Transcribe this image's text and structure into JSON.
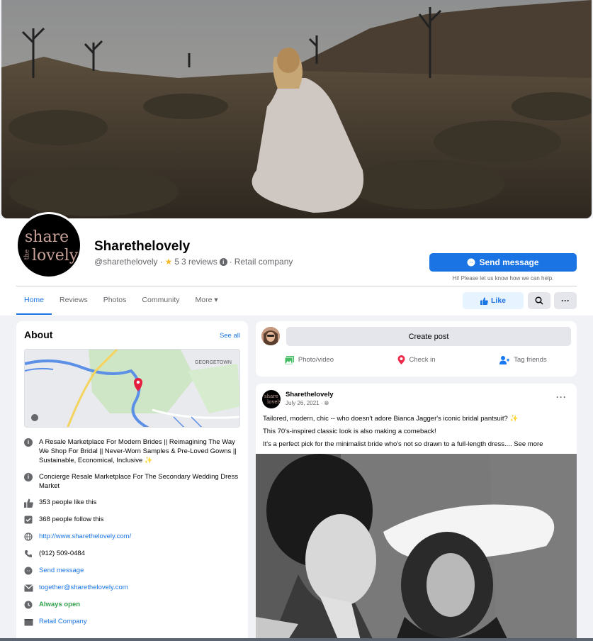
{
  "page": {
    "name": "Sharethelovely",
    "handle": "@sharethelovely",
    "dot1": "·",
    "rating": "5",
    "reviews": "3 reviews",
    "dot2": "·",
    "category": "Retail company",
    "logo_word1": "share",
    "logo_word2": "the",
    "logo_word3": "lovely"
  },
  "actions": {
    "send_message": "Send message",
    "send_sub": "Hi! Please let us know how we can help.",
    "like": "Like"
  },
  "tabs": [
    "Home",
    "Reviews",
    "Photos",
    "Community",
    "More"
  ],
  "about": {
    "title": "About",
    "see_all": "See all",
    "map_label": "GEORGETOWN",
    "items": [
      {
        "icon": "info-icon",
        "text": "A Resale Marketplace For Modern Brides || Reimagining The Way We Shop For Bridal || Never-Worn Samples & Pre-Loved Gowns || Sustainable, Economical, Inclusive ✨"
      },
      {
        "icon": "info-icon",
        "text": "Concierge Resale Marketplace For The Secondary Wedding Dress Market"
      },
      {
        "icon": "thumbs-up-icon",
        "text": "353 people like this"
      },
      {
        "icon": "follow-icon",
        "text": "368 people follow this"
      },
      {
        "icon": "globe-icon",
        "text": "http://www.sharethelovely.com/"
      },
      {
        "icon": "phone-icon",
        "text": "(912) 509-0484"
      },
      {
        "icon": "messenger-icon",
        "text": "Send message"
      },
      {
        "icon": "email-icon",
        "text": "together@sharethelovely.com"
      },
      {
        "icon": "clock-icon",
        "text": "Always open"
      },
      {
        "icon": "category-icon",
        "text": "Retail Company"
      }
    ]
  },
  "create_post": {
    "button": "Create post",
    "photo_video": "Photo/video",
    "check_in": "Check in",
    "tag_friends": "Tag friends"
  },
  "post": {
    "author": "Sharethelovely",
    "date": "July 26, 2021 ·",
    "line1": "Tailored, modern, chic -- who doesn't adore Bianca Jagger's iconic bridal pantsuit? ✨",
    "line2": "This 70's-inspired classic look is also making a comeback!",
    "line3": "It's a perfect pick for the minimalist bride who's not so drawn to a full-length dress....",
    "see_more": "See more"
  },
  "colors": {
    "accent": "#1b74e4",
    "open_green": "#31a24c",
    "star": "#f7b928"
  }
}
